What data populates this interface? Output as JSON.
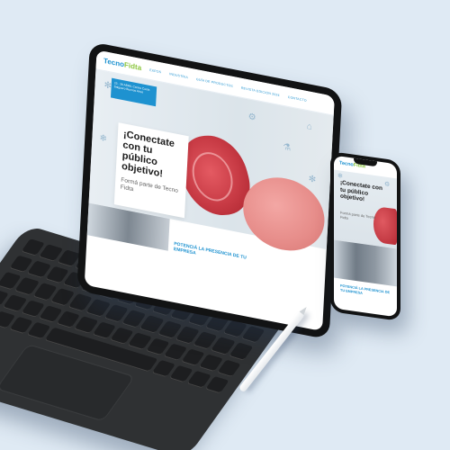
{
  "site": {
    "logo_main": "Tecno",
    "logo_accent": "Fidta",
    "nav": [
      "EXPOS",
      "INDUSTRIA",
      "GUÍA DE PRODUCTOS",
      "REVISTA EDICIÓN 2024",
      "CONTACTO"
    ],
    "date_box": "23 - 26 ABRIL Centro Costa Salguero Buenos Aires",
    "hero_title": "¡Conectate con tu público objetivo!",
    "hero_sub": "Formá parte de Tecno Fidta",
    "strip_text": "POTENCIÁ LA PRESENCIA DE TU EMPRESA"
  },
  "phone": {
    "logo_main": "Tecno",
    "logo_accent": "Fidta",
    "title": "¡Conectate con tu público objetivo!",
    "sub": "Formá parte de Tecno Fidta",
    "strip_text": "POTENCIÁ LA PRESENCIA DE TU EMPRESA"
  },
  "colors": {
    "brand_blue": "#1e92d0",
    "brand_green": "#8cc63f",
    "background": "#dfeaf4"
  }
}
